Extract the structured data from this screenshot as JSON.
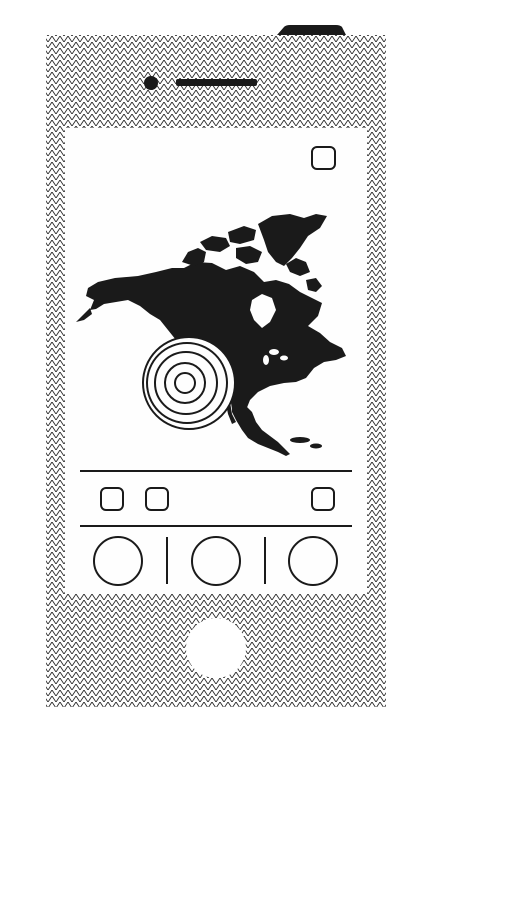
{
  "app": {
    "title": "",
    "accent_color": "#1a1a1a",
    "background_color": "#ffffff",
    "screen_color": "#fefefe"
  },
  "device": {
    "type": "smartphone",
    "pattern": "diagonal-chevron-hatch",
    "camera_icon": "camera-dot-icon",
    "speaker_icon": "speaker-slot-icon",
    "home_button_icon": "home-button-icon",
    "power_button_icon": "power-button-icon"
  },
  "screen": {
    "top_right_icon": "rounded-square-icon",
    "map": {
      "region": "North America",
      "marker_icon": "concentric-circles-target-icon"
    },
    "toolbar": {
      "left_icons": [
        "rounded-square-icon",
        "rounded-square-icon"
      ],
      "right_icon": "rounded-square-icon"
    },
    "bottom_bar": {
      "buttons": [
        "circle-icon",
        "circle-icon",
        "circle-icon"
      ]
    }
  }
}
